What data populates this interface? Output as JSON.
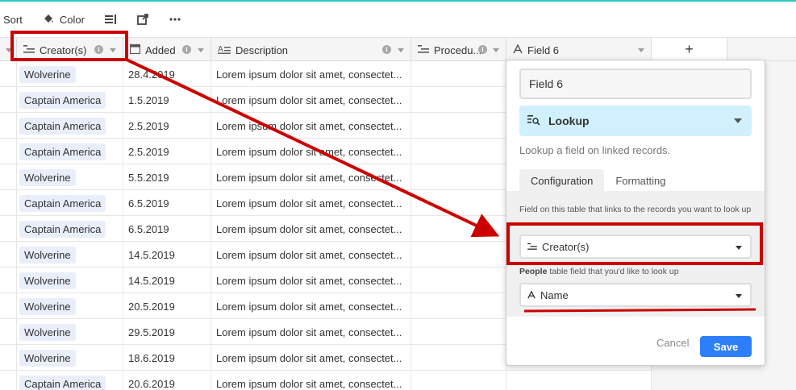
{
  "toolbar": {
    "sort_label": "Sort",
    "color_label": "Color"
  },
  "columns": [
    {
      "label": "Creator(s)",
      "icon": "multiline-icon"
    },
    {
      "label": "Added",
      "icon": "calendar-icon"
    },
    {
      "label": "Description",
      "icon": "long-text-icon"
    },
    {
      "label": "Procedu...",
      "icon": "multiline-icon"
    },
    {
      "label": "Field 6",
      "icon": "text-a-icon"
    }
  ],
  "add_column_label": "+",
  "rows": [
    {
      "creator": "Wolverine",
      "added": "28.4.2019",
      "description": "Lorem ipsum dolor sit amet, consectet..."
    },
    {
      "creator": "Captain America",
      "added": "1.5.2019",
      "description": "Lorem ipsum dolor sit amet, consectet..."
    },
    {
      "creator": "Captain America",
      "added": "2.5.2019",
      "description": "Lorem ipsum dolor sit amet, consectet..."
    },
    {
      "creator": "Captain America",
      "added": "2.5.2019",
      "description": "Lorem ipsum dolor sit amet, consectet..."
    },
    {
      "creator": "Wolverine",
      "added": "5.5.2019",
      "description": "Lorem ipsum dolor sit amet, consectet..."
    },
    {
      "creator": "Captain America",
      "added": "6.5.2019",
      "description": "Lorem ipsum dolor sit amet, consectet..."
    },
    {
      "creator": "Captain America",
      "added": "6.5.2019",
      "description": "Lorem ipsum dolor sit amet, consectet..."
    },
    {
      "creator": "Wolverine",
      "added": "14.5.2019",
      "description": "Lorem ipsum dolor sit amet, consectet..."
    },
    {
      "creator": "Wolverine",
      "added": "14.5.2019",
      "description": "Lorem ipsum dolor sit amet, consectet..."
    },
    {
      "creator": "Wolverine",
      "added": "20.5.2019",
      "description": "Lorem ipsum dolor sit amet, consectet..."
    },
    {
      "creator": "Wolverine",
      "added": "29.5.2019",
      "description": "Lorem ipsum dolor sit amet, consectet..."
    },
    {
      "creator": "Wolverine",
      "added": "18.6.2019",
      "description": "Lorem ipsum dolor sit amet, consectet..."
    },
    {
      "creator": "Captain America",
      "added": "20.6.2019",
      "description": "Lorem ipsum dolor sit amet, consectet..."
    }
  ],
  "popup": {
    "field_name": "Field 6",
    "field_type": "Lookup",
    "type_description": "Lookup a field on linked records.",
    "tab_configuration": "Configuration",
    "tab_formatting": "Formatting",
    "link_label": "Field on this table that links to the records you want to look up",
    "link_value": "Creator(s)",
    "lookup_label_strong": "People",
    "lookup_label_rest": " table field that you'd like to look up",
    "lookup_value": "Name",
    "cancel_label": "Cancel",
    "save_label": "Save"
  },
  "colors": {
    "annotation_red": "#cc0000",
    "save_blue": "#2d7ff9",
    "lookup_bg": "#d0f0fd",
    "chip_bg": "#e9eefb"
  }
}
